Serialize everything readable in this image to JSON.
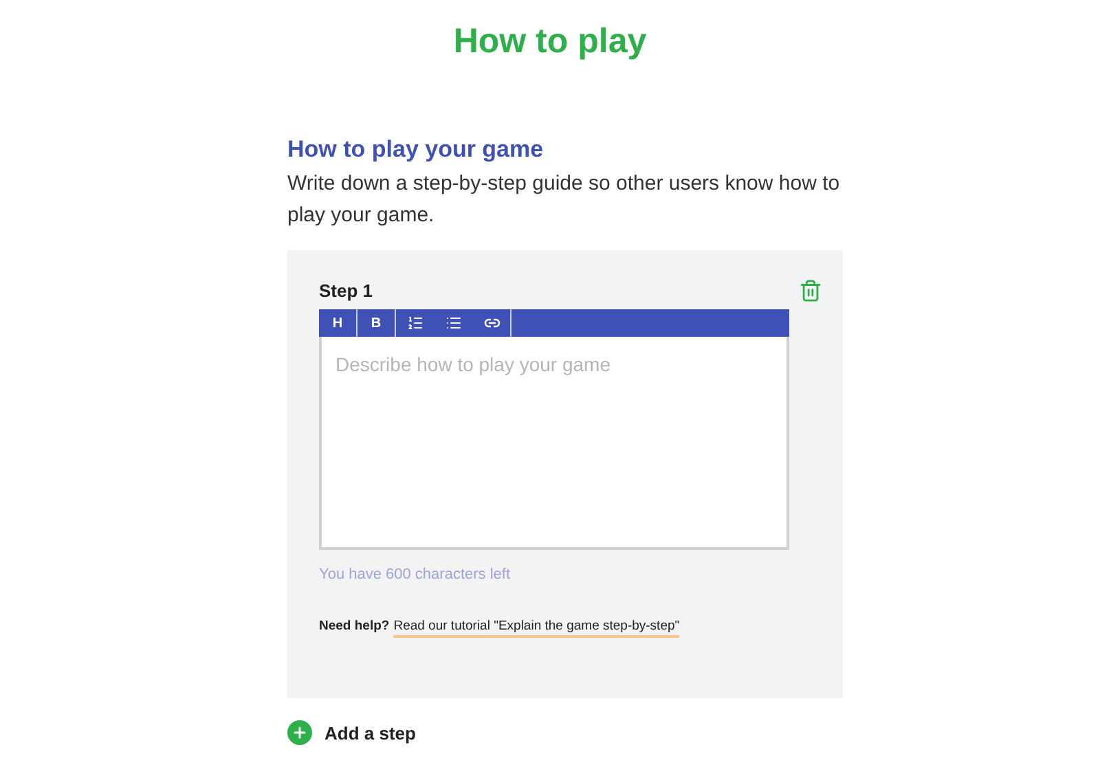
{
  "page_title": "How to play",
  "section": {
    "heading": "How to play your game",
    "description": "Write down a step-by-step guide so other users know how to play your game."
  },
  "steps": [
    {
      "label": "Step 1",
      "toolbar": [
        {
          "kind": "text",
          "label": "H"
        },
        {
          "kind": "text",
          "label": "B"
        },
        {
          "kind": "ordered-list"
        },
        {
          "kind": "bullet-list"
        },
        {
          "kind": "link"
        }
      ],
      "placeholder": "Describe how to play your game",
      "counter": "You have 600 characters left",
      "help_label": "Need help?",
      "help_link": "Read our tutorial \"Explain the game step-by-step\""
    }
  ],
  "add_step": "Add a step"
}
